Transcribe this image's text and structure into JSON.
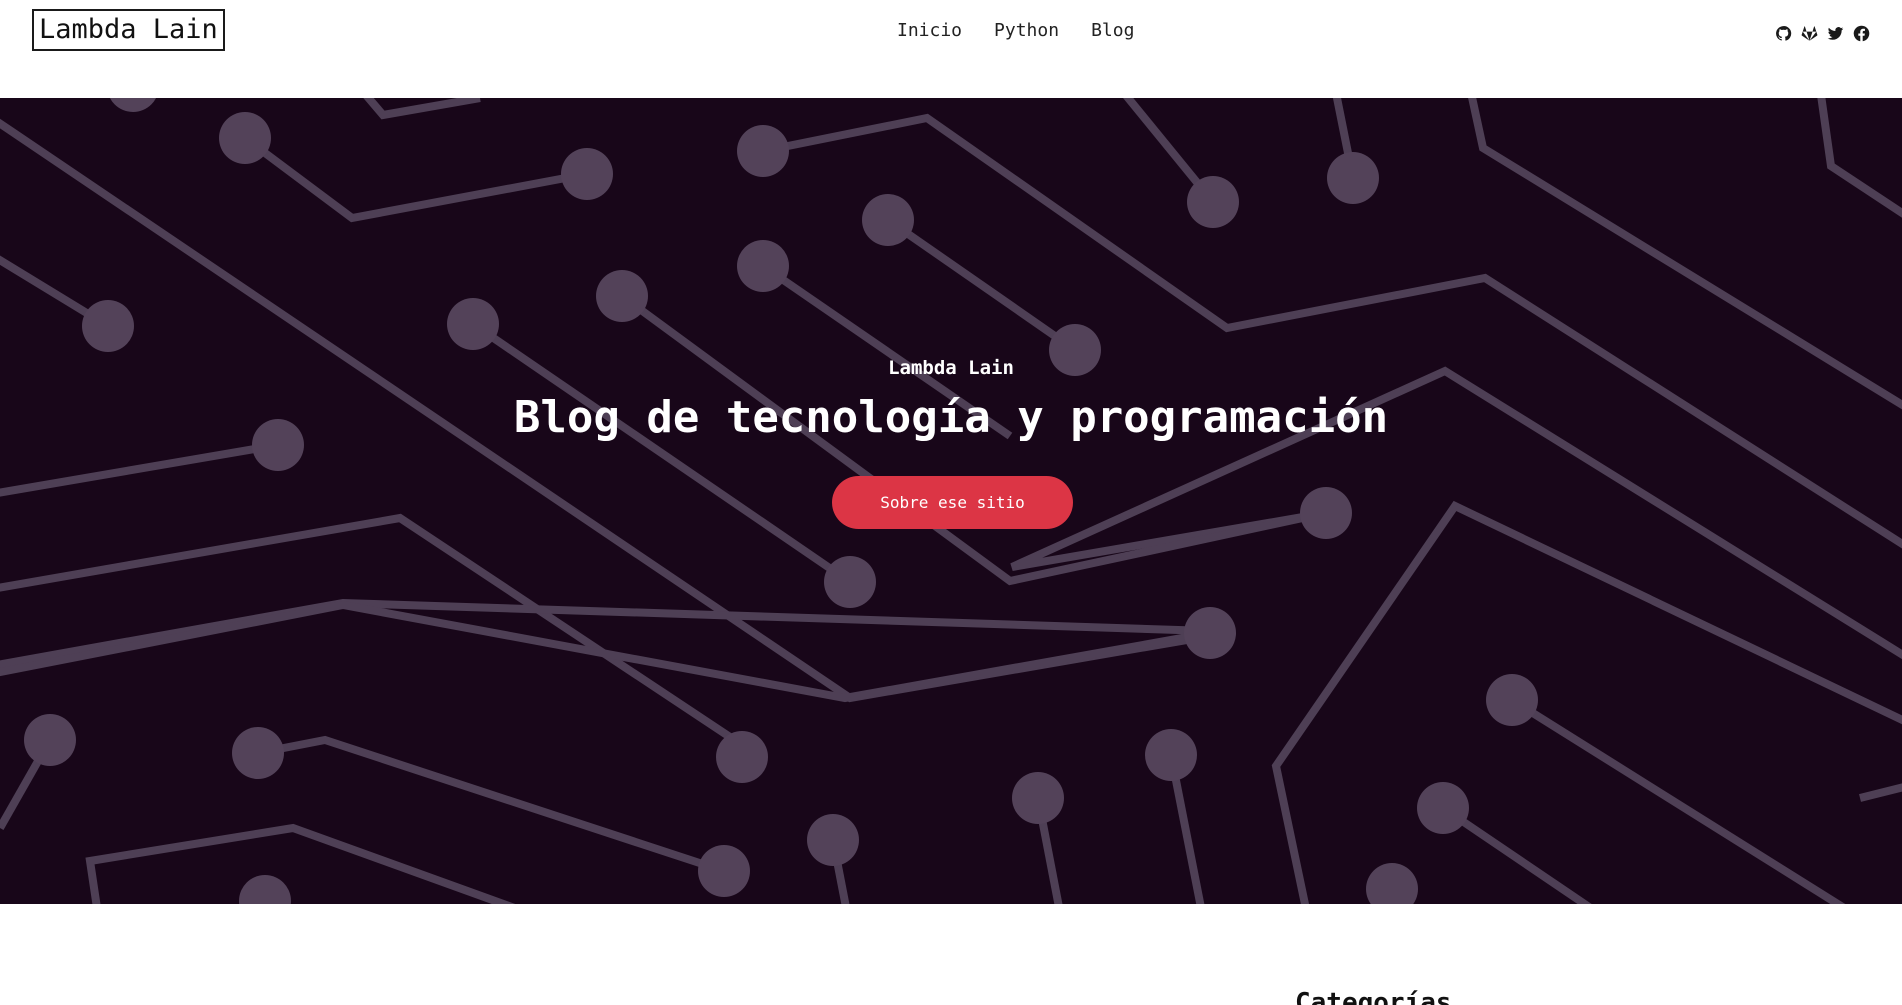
{
  "header": {
    "logo": "Lambda Lain",
    "nav": [
      {
        "label": "Inicio"
      },
      {
        "label": "Python"
      },
      {
        "label": "Blog"
      }
    ],
    "social": [
      {
        "icon": "github-icon"
      },
      {
        "icon": "gitlab-icon"
      },
      {
        "icon": "twitter-icon"
      },
      {
        "icon": "facebook-icon"
      }
    ]
  },
  "hero": {
    "kicker": "Lambda Lain",
    "title": "Blog de tecnología y programación",
    "button_label": "Sobre ese sitio",
    "colors": {
      "background": "#180619",
      "trace": "#4e3f55",
      "button": "#dc3545"
    }
  },
  "sidebar": {
    "heading": "Categorías"
  }
}
